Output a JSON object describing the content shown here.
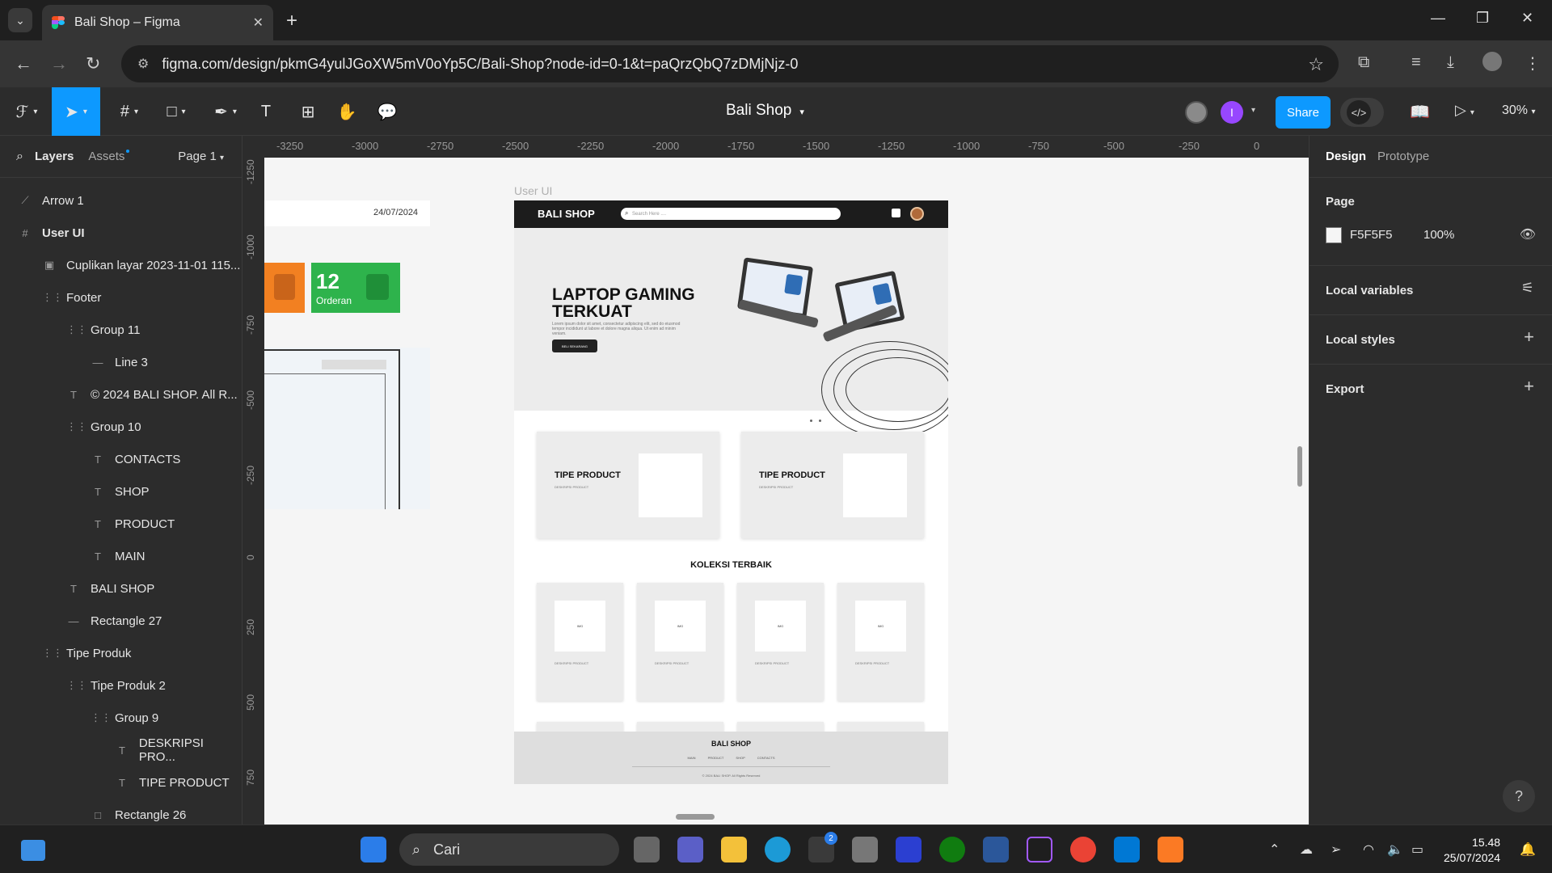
{
  "browser": {
    "tab_title": "Bali Shop – Figma",
    "url": "figma.com/design/pkmG4yulJGoXW5mV0oYp5C/Bali-Shop?node-id=0-1&t=paQrzQbQ7zDMjNjz-0"
  },
  "figma": {
    "file_name": "Bali Shop",
    "share_label": "Share",
    "zoom": "30%",
    "avatar_initial": "I"
  },
  "left_panel": {
    "tab_layers": "Layers",
    "tab_assets": "Assets",
    "page_selector": "Page 1",
    "layers": [
      {
        "name": "Arrow 1",
        "icon": "arrow-icon",
        "indent": 0,
        "bold": false
      },
      {
        "name": "User UI",
        "icon": "frame-icon",
        "indent": 0,
        "bold": true
      },
      {
        "name": "Cuplikan layar 2023-11-01 115...",
        "icon": "image-icon",
        "indent": 1,
        "bold": false
      },
      {
        "name": "Footer",
        "icon": "group-icon",
        "indent": 1,
        "bold": false
      },
      {
        "name": "Group 11",
        "icon": "group-icon",
        "indent": 2,
        "bold": false
      },
      {
        "name": "Line 3",
        "icon": "line-icon",
        "indent": 3,
        "bold": false
      },
      {
        "name": "© 2024 BALI SHOP. All R...",
        "icon": "text-icon",
        "indent": 2,
        "bold": false
      },
      {
        "name": "Group 10",
        "icon": "group-icon",
        "indent": 2,
        "bold": false
      },
      {
        "name": "CONTACTS",
        "icon": "text-icon",
        "indent": 3,
        "bold": false
      },
      {
        "name": "SHOP",
        "icon": "text-icon",
        "indent": 3,
        "bold": false
      },
      {
        "name": "PRODUCT",
        "icon": "text-icon",
        "indent": 3,
        "bold": false
      },
      {
        "name": "MAIN",
        "icon": "text-icon",
        "indent": 3,
        "bold": false
      },
      {
        "name": "BALI SHOP",
        "icon": "text-icon",
        "indent": 2,
        "bold": false
      },
      {
        "name": "Rectangle 27",
        "icon": "line-icon",
        "indent": 2,
        "bold": false
      },
      {
        "name": "Tipe Produk",
        "icon": "group-icon",
        "indent": 1,
        "bold": false
      },
      {
        "name": "Tipe Produk 2",
        "icon": "group-icon",
        "indent": 2,
        "bold": false
      },
      {
        "name": "Group 9",
        "icon": "group-icon",
        "indent": 3,
        "bold": false
      },
      {
        "name": "DESKRIPSI PRO...",
        "icon": "text-icon",
        "indent": 4,
        "bold": false
      },
      {
        "name": "TIPE PRODUCT",
        "icon": "text-icon",
        "indent": 4,
        "bold": false
      },
      {
        "name": "Rectangle 26",
        "icon": "rectangle-icon",
        "indent": 3,
        "bold": false
      }
    ]
  },
  "rulers": {
    "top": [
      "-3250",
      "-3000",
      "-2750",
      "-2500",
      "-2250",
      "-2000",
      "-1750",
      "-1500",
      "-1250",
      "-1000",
      "-750",
      "-500",
      "-250",
      "0"
    ],
    "left": [
      "-1250",
      "-1000",
      "-750",
      "-500",
      "-250",
      "0",
      "250",
      "500",
      "750"
    ]
  },
  "canvas": {
    "frame_label": "User UI",
    "partial": {
      "date": "24/07/2024",
      "order_count": "12",
      "order_label": "Orderan"
    },
    "design": {
      "brand": "BALI SHOP",
      "search_placeholder": "Search Here ....",
      "hero_title": "LAPTOP GAMING TERKUAT",
      "hero_body": "Lorem ipsum dolor sit amet, consectetur adipiscing elit, sed do eiusmod tempor incididunt ut labore et dolore magna aliqua. Ut enim ad minim veniam.",
      "hero_cta": "BELI SEKARANG",
      "type_cards": [
        {
          "title": "TIPE PRODUCT",
          "desc": "DESKRIPSI PRODUCT"
        },
        {
          "title": "TIPE PRODUCT",
          "desc": "DESKRIPSI PRODUCT"
        }
      ],
      "collection_title": "KOLEKSI TERBAIK",
      "collection_cards": [
        {
          "img": "IMG",
          "desc": "DESKRIPSI PRODUCT"
        },
        {
          "img": "IMG",
          "desc": "DESKRIPSI PRODUCT"
        },
        {
          "img": "IMG",
          "desc": "DESKRIPSI PRODUCT"
        },
        {
          "img": "IMG",
          "desc": "DESKRIPSI PRODUCT"
        }
      ],
      "footer_brand": "BALI SHOP",
      "footer_links": "MAIN PRODUCT SHOP CONTACTS",
      "footer_copy": "© 2024 BALI SHOP. All Rights Reserved"
    }
  },
  "right_panel": {
    "tab_design": "Design",
    "tab_prototype": "Prototype",
    "page_heading": "Page",
    "page_color": "F5F5F5",
    "page_opacity": "100%",
    "local_variables": "Local variables",
    "local_styles": "Local styles",
    "export": "Export"
  },
  "taskbar": {
    "search_label": "Cari",
    "time": "15.48",
    "date": "25/07/2024",
    "store_badge": "2"
  },
  "colors": {
    "figma_blue": "#0d99ff",
    "canvas_bg": "#f5f5f5",
    "order_green": "#2eb34c",
    "order_orange": "#f28021"
  }
}
